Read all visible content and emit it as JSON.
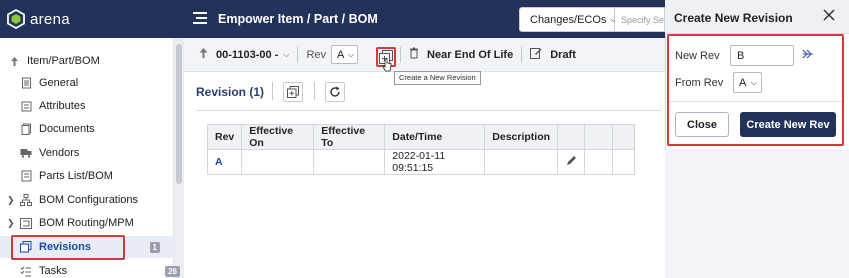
{
  "app": {
    "logo_text": "arena"
  },
  "header": {
    "title": "Empower Item / Part / BOM",
    "changes_label": "Changes/ECOs",
    "search_placeholder": "Specify Search"
  },
  "sidebar": {
    "items": [
      {
        "label": "Item/Part/BOM",
        "icon": "pin-icon"
      },
      {
        "label": "General",
        "icon": "document-icon"
      },
      {
        "label": "Attributes",
        "icon": "list-icon"
      },
      {
        "label": "Documents",
        "icon": "files-icon"
      },
      {
        "label": "Vendors",
        "icon": "truck-icon"
      },
      {
        "label": "Parts List/BOM",
        "icon": "parts-icon"
      },
      {
        "label": "BOM Configurations",
        "icon": "hierarchy-icon"
      },
      {
        "label": "BOM Routing/MPM",
        "icon": "routing-icon"
      },
      {
        "label": "Revisions",
        "icon": "revisions-icon",
        "count": "1"
      },
      {
        "label": "Tasks",
        "icon": "tasks-icon",
        "count": "26"
      }
    ]
  },
  "toolbar": {
    "item_number": "00-1103-00 -",
    "rev_label": "Rev",
    "rev_value": "A",
    "lifecycle": "Near End Of Life",
    "status": "Draft",
    "tooltip": "Create a New Revision"
  },
  "revision_panel": {
    "heading": "Revision (1)",
    "columns": [
      "Rev",
      "Effective On",
      "Effective To",
      "Date/Time",
      "Description"
    ],
    "rows": [
      {
        "rev": "A",
        "effective_on": "",
        "effective_to": "",
        "datetime": "2022-01-11 09:51:15",
        "description": ""
      }
    ]
  },
  "dialog": {
    "title": "Create New Revision",
    "new_rev_label": "New Rev",
    "new_rev_value": "B",
    "from_rev_label": "From Rev",
    "from_rev_value": "A",
    "close_label": "Close",
    "create_label": "Create New Rev"
  },
  "colors": {
    "header": "#23325a",
    "highlight": "#d03a3a",
    "link": "#1c4aa0"
  }
}
